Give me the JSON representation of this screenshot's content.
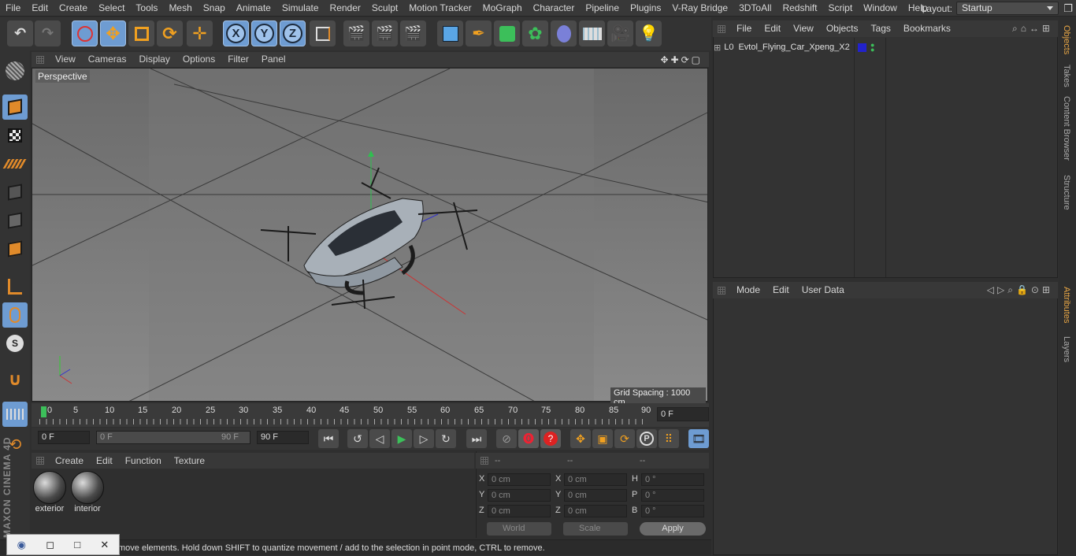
{
  "menubar": {
    "items": [
      "File",
      "Edit",
      "Create",
      "Select",
      "Tools",
      "Mesh",
      "Snap",
      "Animate",
      "Simulate",
      "Render",
      "Sculpt",
      "Motion Tracker",
      "MoGraph",
      "Character",
      "Pipeline",
      "Plugins",
      "V-Ray Bridge",
      "3DToAll",
      "Redshift",
      "Script",
      "Window",
      "Help"
    ],
    "layout_label": "Layout:",
    "layout_value": "Startup"
  },
  "toolbar": {
    "axis_x": "X",
    "axis_y": "Y",
    "axis_z": "Z"
  },
  "viewport": {
    "menu": [
      "View",
      "Cameras",
      "Display",
      "Options",
      "Filter",
      "Panel"
    ],
    "camera_label": "Perspective",
    "grid_spacing": "Grid Spacing : 1000 cm"
  },
  "timeline": {
    "ticks": [
      "0",
      "5",
      "10",
      "15",
      "20",
      "25",
      "30",
      "35",
      "40",
      "45",
      "50",
      "55",
      "60",
      "65",
      "70",
      "75",
      "80",
      "85",
      "90"
    ],
    "current_frame": "0 F",
    "start_field": "0 F",
    "range_start": "0 F",
    "range_end": "90 F",
    "end_field": "90 F"
  },
  "materials": {
    "menu": [
      "Create",
      "Edit",
      "Function",
      "Texture"
    ],
    "items": [
      "exterior",
      "interior"
    ]
  },
  "coordinates": {
    "headers": [
      "--",
      "--",
      "--"
    ],
    "pos_labels": [
      "X",
      "Y",
      "Z"
    ],
    "size_labels": [
      "X",
      "Y",
      "Z"
    ],
    "rot_labels": [
      "H",
      "P",
      "B"
    ],
    "pos_values": [
      "0 cm",
      "0 cm",
      "0 cm"
    ],
    "size_values": [
      "0 cm",
      "0 cm",
      "0 cm"
    ],
    "rot_values": [
      "0 °",
      "0 °",
      "0 °"
    ],
    "mode_dropdown": "World",
    "scale_dropdown": "Scale",
    "apply_label": "Apply"
  },
  "status": {
    "text": "move elements. Hold down SHIFT to quantize movement / add to the selection in point mode, CTRL to remove."
  },
  "objects": {
    "menu": [
      "File",
      "Edit",
      "View",
      "Objects",
      "Tags",
      "Bookmarks"
    ],
    "object_name": "Evtol_Flying_Car_Xpeng_X2"
  },
  "attributes": {
    "menu": [
      "Mode",
      "Edit",
      "User Data"
    ]
  },
  "right_tabs": [
    "Objects",
    "Takes",
    "Content Browser",
    "Structure",
    "Attributes",
    "Layers"
  ],
  "branding": "MAXON CINEMA 4D",
  "colors": {
    "accent": "#6e9cd2",
    "active_tab": "#e6a545",
    "object_tag": "#2222cc"
  }
}
